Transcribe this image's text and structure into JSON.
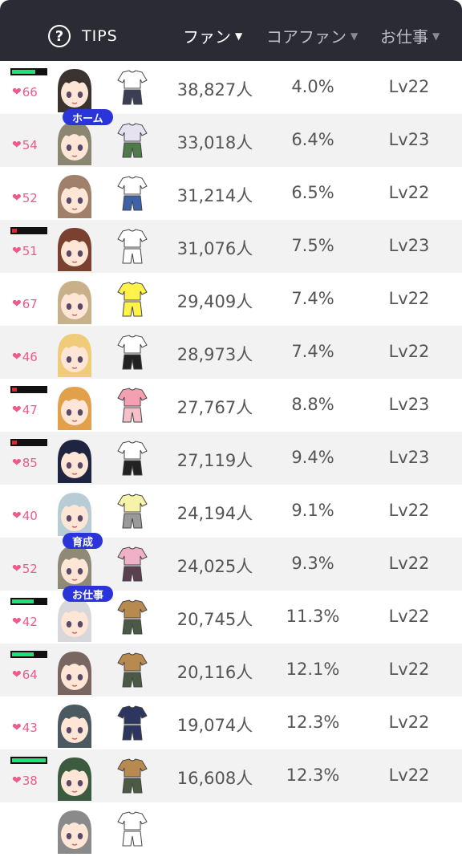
{
  "header": {
    "tips_icon": "?",
    "tips_label": "TIPS",
    "columns": [
      {
        "label": "ファン",
        "arrow": "▼"
      },
      {
        "label": "コアファン",
        "arrow": "▼"
      },
      {
        "label": "お仕事",
        "arrow": "▼"
      }
    ]
  },
  "colors": {
    "header_bg": "#2b2b35",
    "heart": "#ee5a8a",
    "tag_bg": "#2a34d8",
    "bar_green": "#21e07a",
    "bar_red": "#e0262c"
  },
  "rows": [
    {
      "hearts": "66",
      "fans": "38,827人",
      "core": "4.0%",
      "level": "Lv22",
      "tag": "",
      "bar": "green",
      "bar_level": 0.7,
      "hair": "#3a3330",
      "outfit_top": "#ffffff",
      "outfit_bottom": "#3b3f55"
    },
    {
      "hearts": "54",
      "fans": "33,018人",
      "core": "6.4%",
      "level": "Lv23",
      "tag": "ホーム",
      "bar": "",
      "bar_level": 0,
      "hair": "#8a8672",
      "outfit_top": "#e6e2f0",
      "outfit_bottom": "#4f7a4a"
    },
    {
      "hearts": "52",
      "fans": "31,214人",
      "core": "6.5%",
      "level": "Lv22",
      "tag": "",
      "bar": "",
      "bar_level": 0,
      "hair": "#a0806a",
      "outfit_top": "#ffffff",
      "outfit_bottom": "#3d62a8"
    },
    {
      "hearts": "51",
      "fans": "31,076人",
      "core": "7.5%",
      "level": "Lv23",
      "tag": "",
      "bar": "red",
      "bar_level": 0.15,
      "hair": "#7a4030",
      "outfit_top": "#ffffff",
      "outfit_bottom": "#ffffff"
    },
    {
      "hearts": "67",
      "fans": "29,409人",
      "core": "7.4%",
      "level": "Lv22",
      "tag": "",
      "bar": "",
      "bar_level": 0,
      "hair": "#c8b08a",
      "outfit_top": "#fff34a",
      "outfit_bottom": "#fff34a"
    },
    {
      "hearts": "46",
      "fans": "28,973人",
      "core": "7.4%",
      "level": "Lv22",
      "tag": "",
      "bar": "",
      "bar_level": 0,
      "hair": "#f0cc7a",
      "outfit_top": "#ffffff",
      "outfit_bottom": "#222222"
    },
    {
      "hearts": "47",
      "fans": "27,767人",
      "core": "8.8%",
      "level": "Lv23",
      "tag": "",
      "bar": "red",
      "bar_level": 0.15,
      "hair": "#e2a04a",
      "outfit_top": "#f5a0b0",
      "outfit_bottom": "#f5c0c8"
    },
    {
      "hearts": "85",
      "fans": "27,119人",
      "core": "9.4%",
      "level": "Lv23",
      "tag": "",
      "bar": "red",
      "bar_level": 0.15,
      "hair": "#1f2540",
      "outfit_top": "#ffffff",
      "outfit_bottom": "#222222"
    },
    {
      "hearts": "40",
      "fans": "24,194人",
      "core": "9.1%",
      "level": "Lv22",
      "tag": "",
      "bar": "",
      "bar_level": 0,
      "hair": "#b8ccd6",
      "outfit_top": "#f6f3a8",
      "outfit_bottom": "#9a9a9a"
    },
    {
      "hearts": "52",
      "fans": "24,025人",
      "core": "9.3%",
      "level": "Lv22",
      "tag": "育成",
      "bar": "",
      "bar_level": 0,
      "hair": "#8f8a78",
      "outfit_top": "#f0b0c8",
      "outfit_bottom": "#5a4050"
    },
    {
      "hearts": "42",
      "fans": "20,745人",
      "core": "11.3%",
      "level": "Lv22",
      "tag": "お仕事",
      "bar": "green",
      "bar_level": 0.65,
      "hair": "#d8d8dc",
      "outfit_top": "#b88a50",
      "outfit_bottom": "#4a5a44"
    },
    {
      "hearts": "64",
      "fans": "20,116人",
      "core": "12.1%",
      "level": "Lv22",
      "tag": "",
      "bar": "green",
      "bar_level": 0.65,
      "hair": "#7a6660",
      "outfit_top": "#b88a50",
      "outfit_bottom": "#4a5a44"
    },
    {
      "hearts": "43",
      "fans": "19,074人",
      "core": "12.3%",
      "level": "Lv22",
      "tag": "",
      "bar": "",
      "bar_level": 0,
      "hair": "#4a5a60",
      "outfit_top": "#2c3660",
      "outfit_bottom": "#2c3660"
    },
    {
      "hearts": "38",
      "fans": "16,608人",
      "core": "12.3%",
      "level": "Lv22",
      "tag": "",
      "bar": "green",
      "bar_level": 1.0,
      "hair": "#3c5a40",
      "outfit_top": "#b88a50",
      "outfit_bottom": "#4a5a44"
    },
    {
      "hearts": "",
      "fans": "",
      "core": "",
      "level": "",
      "tag": "",
      "bar": "",
      "bar_level": 0,
      "hair": "#8a8a8a",
      "outfit_top": "#ffffff",
      "outfit_bottom": "#ffffff"
    }
  ]
}
